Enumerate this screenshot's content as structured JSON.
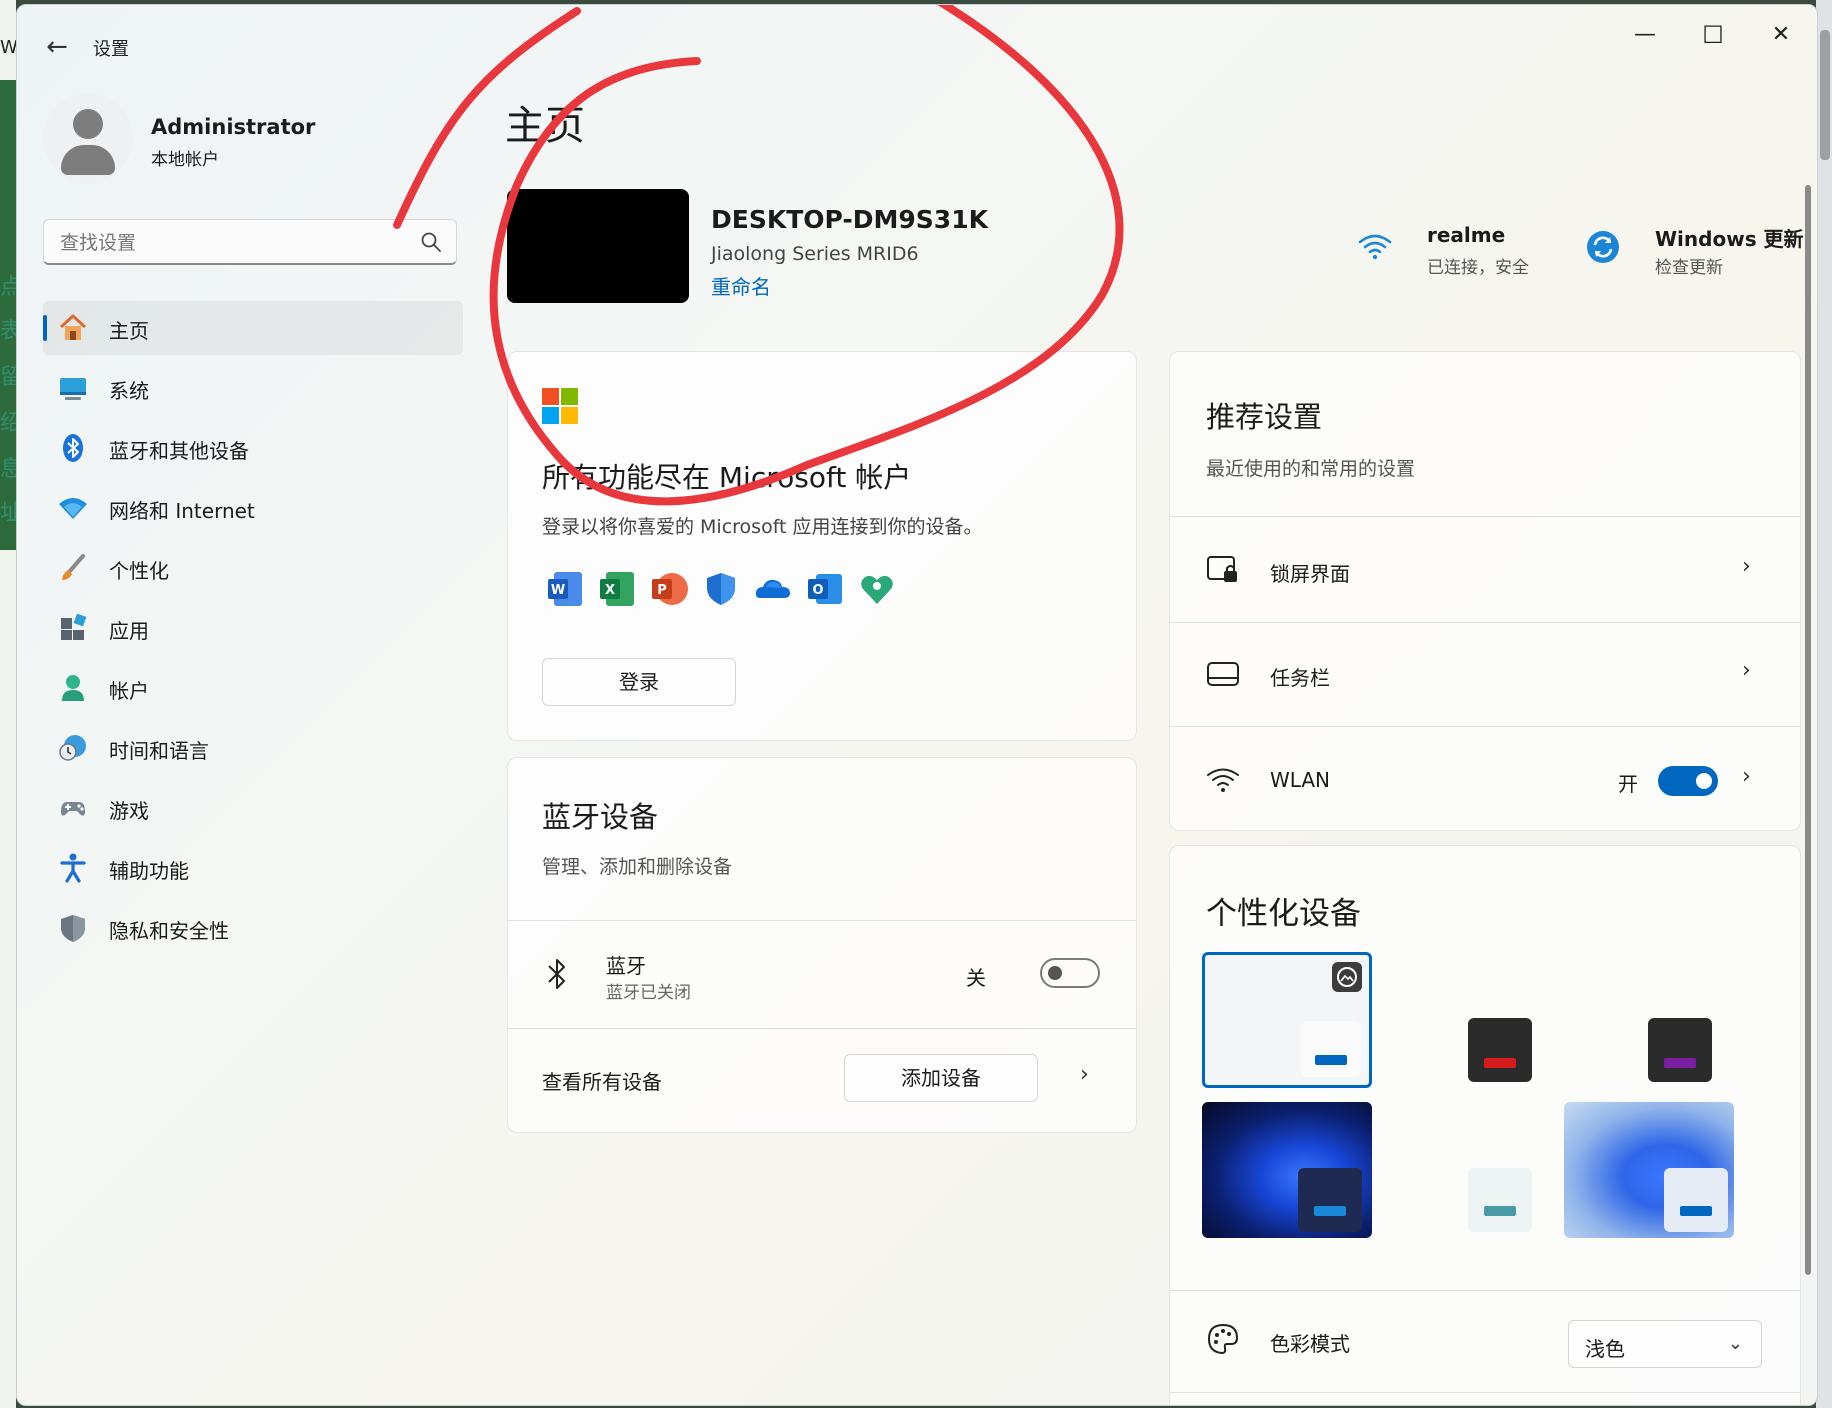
{
  "background": {
    "left_fragments": [
      "W.",
      "点",
      "表",
      "留",
      "绍",
      "息",
      "址"
    ]
  },
  "window": {
    "title": "设置",
    "back_glyph": "←",
    "controls": {
      "minimize": "—",
      "maximize": "☐",
      "close": "✕"
    }
  },
  "profile": {
    "name": "Administrator",
    "type": "本地帐户"
  },
  "search": {
    "placeholder": "查找设置"
  },
  "nav": {
    "items": [
      {
        "label": "主页",
        "icon": "home-icon",
        "active": true
      },
      {
        "label": "系统",
        "icon": "system-icon"
      },
      {
        "label": "蓝牙和其他设备",
        "icon": "bluetooth-icon"
      },
      {
        "label": "网络和 Internet",
        "icon": "network-icon"
      },
      {
        "label": "个性化",
        "icon": "brush-icon"
      },
      {
        "label": "应用",
        "icon": "apps-icon"
      },
      {
        "label": "帐户",
        "icon": "account-icon"
      },
      {
        "label": "时间和语言",
        "icon": "time-language-icon"
      },
      {
        "label": "游戏",
        "icon": "gaming-icon"
      },
      {
        "label": "辅助功能",
        "icon": "accessibility-icon"
      },
      {
        "label": "隐私和安全性",
        "icon": "shield-icon"
      }
    ]
  },
  "main": {
    "page_title": "主页",
    "device": {
      "name": "DESKTOP-DM9S31K",
      "model": "Jiaolong Series MRID6",
      "rename": "重命名"
    },
    "status": {
      "wifi": {
        "title": "realme",
        "subtitle": "已连接，安全"
      },
      "update": {
        "title": "Windows 更新",
        "subtitle": "检查更新"
      }
    },
    "ms_account": {
      "title": "所有功能尽在 Microsoft 帐户",
      "description": "登录以将你喜爱的 Microsoft 应用连接到你的设备。",
      "apps": [
        "word-icon",
        "excel-icon",
        "powerpoint-icon",
        "defender-icon",
        "onedrive-icon",
        "outlook-icon",
        "family-icon"
      ],
      "signin_label": "登录"
    },
    "bluetooth": {
      "title": "蓝牙设备",
      "description": "管理、添加和删除设备",
      "name": "蓝牙",
      "state": "蓝牙已关闭",
      "toggle_label": "关",
      "toggle_on": false,
      "see_all": "查看所有设备",
      "add_device": "添加设备"
    },
    "recommended": {
      "title": "推荐设置",
      "description": "最近使用的和常用的设置",
      "rows": [
        {
          "label": "锁屏界面",
          "icon": "lock-screen-icon"
        },
        {
          "label": "任务栏",
          "icon": "taskbar-icon"
        },
        {
          "label": "WLAN",
          "icon": "wifi-icon",
          "toggle_label": "开",
          "toggle_on": true
        }
      ]
    },
    "personalize": {
      "title": "个性化设备",
      "color_mode_label": "色彩模式",
      "color_mode_value": "浅色"
    }
  },
  "colors": {
    "accent": "#0067c0",
    "annotation": "#e8383d"
  }
}
